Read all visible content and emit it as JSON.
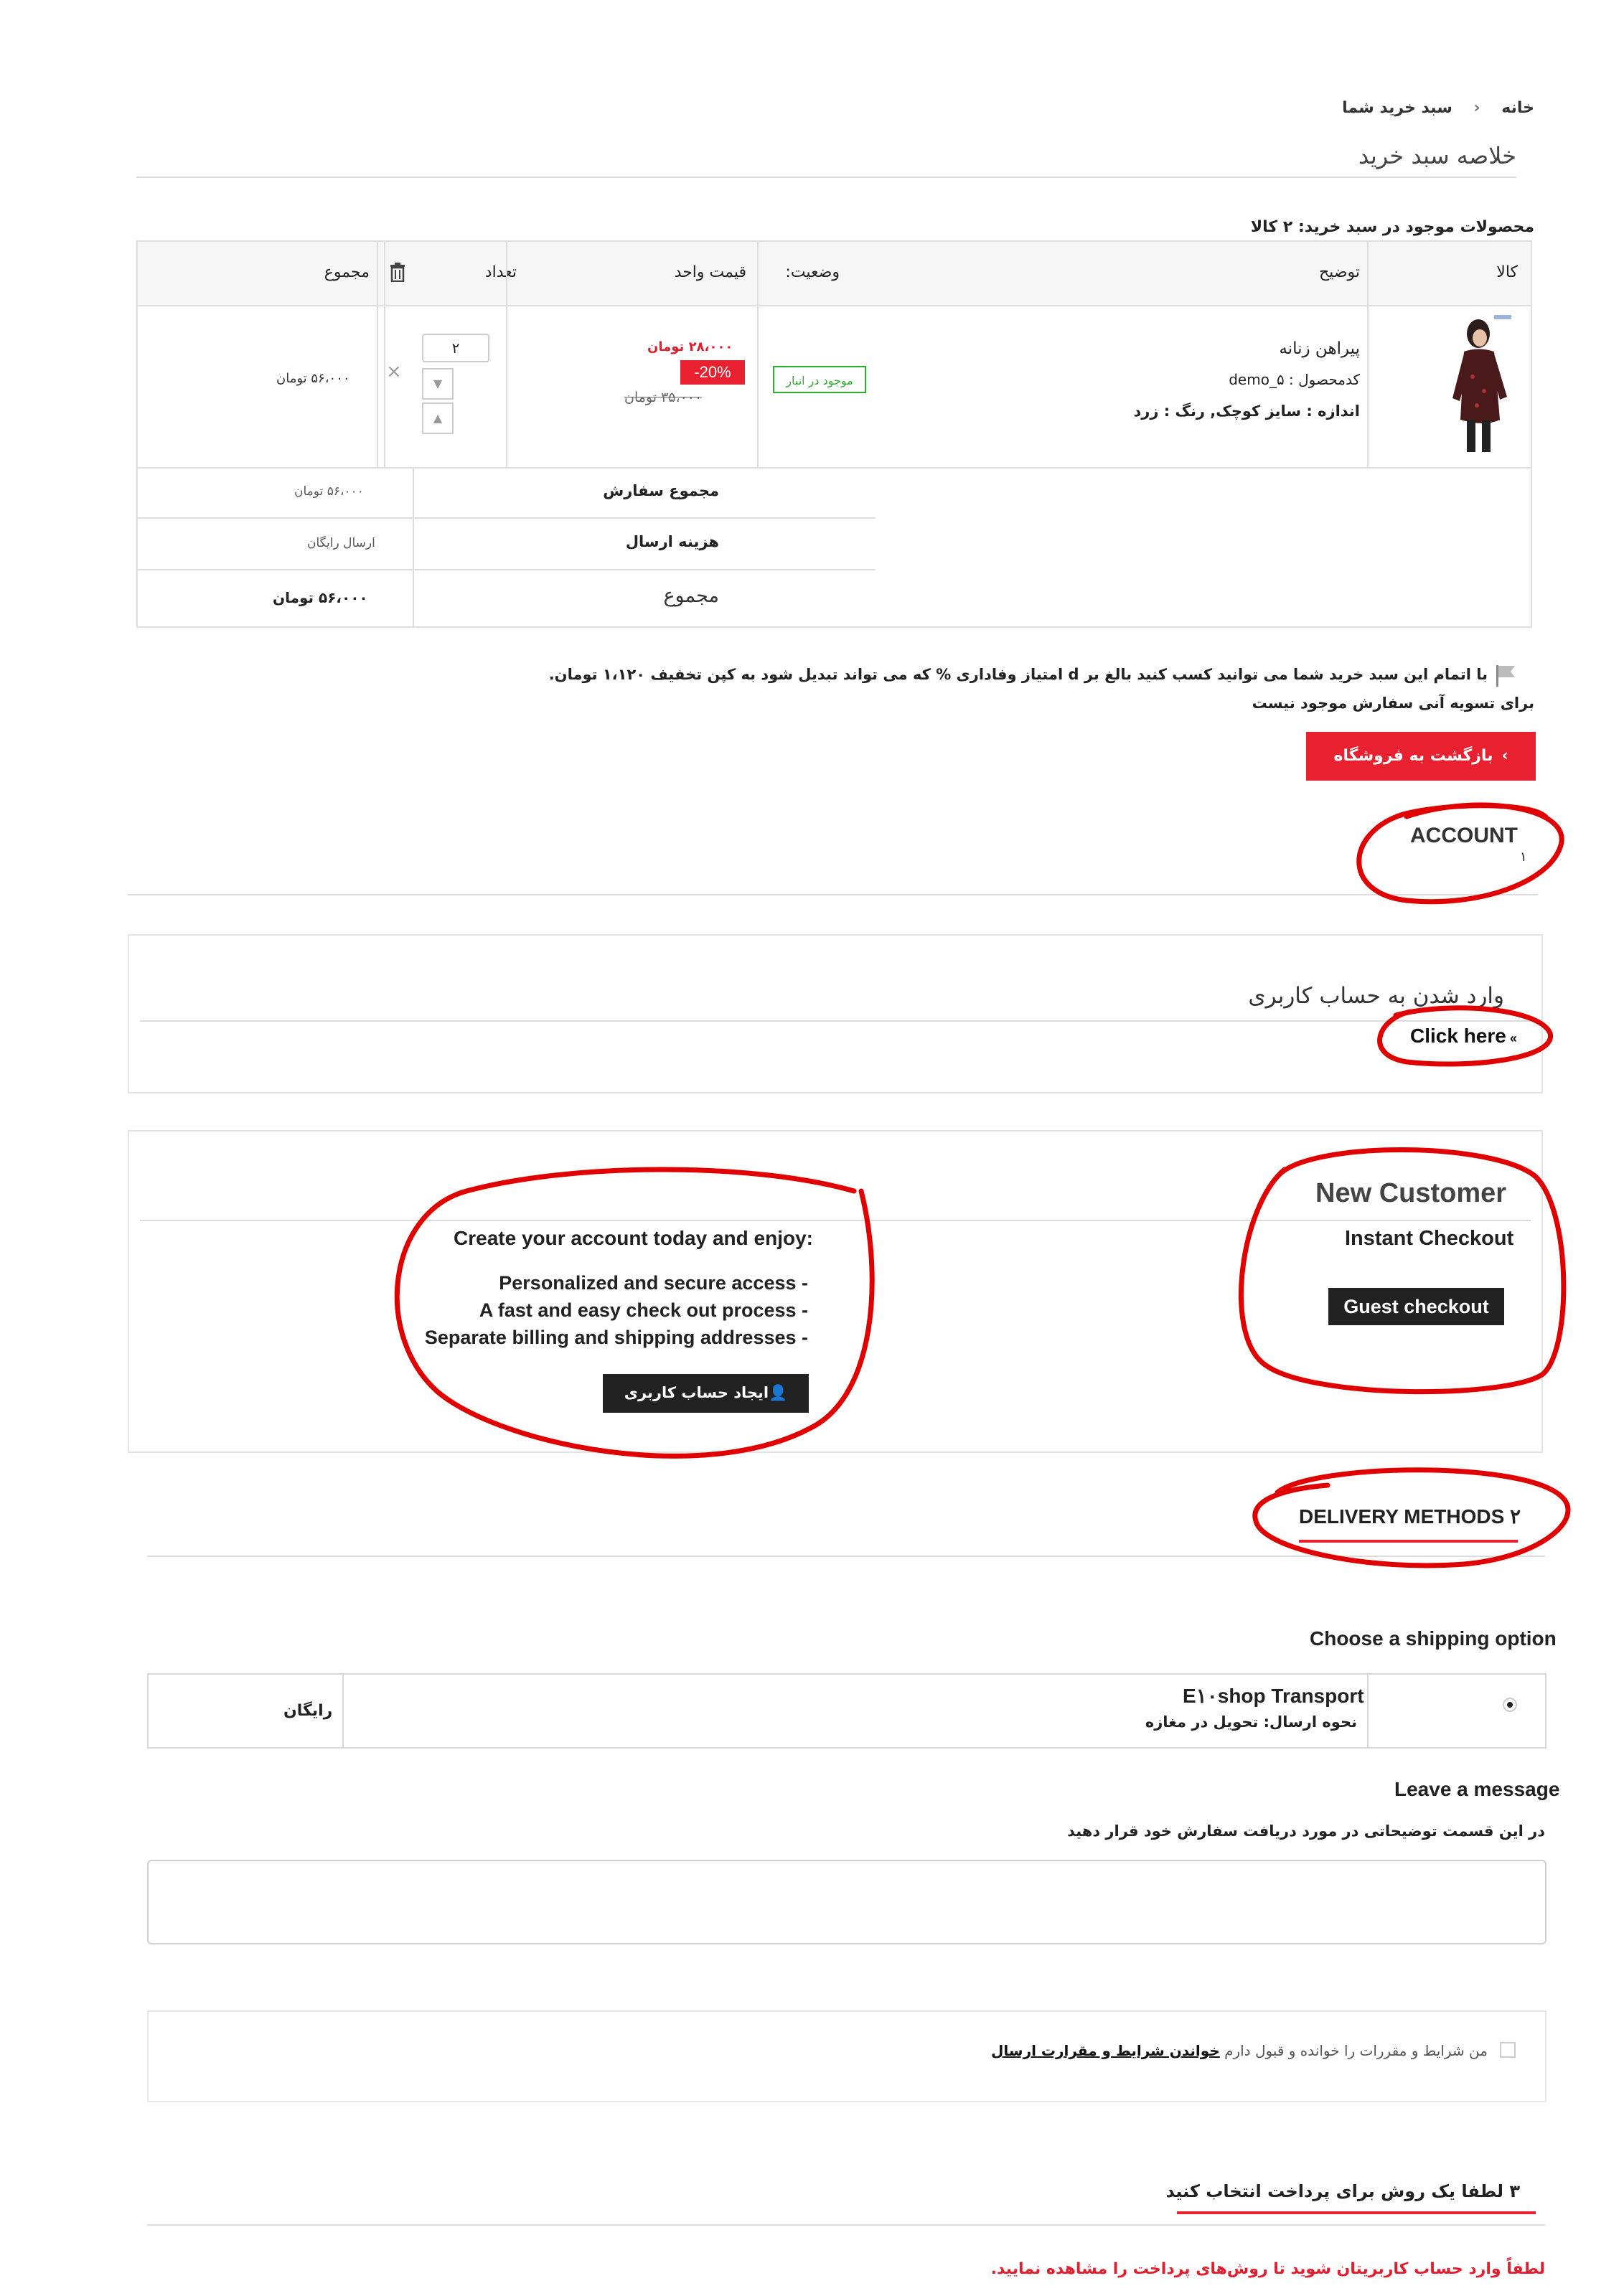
{
  "breadcrumb": {
    "home": "خانه",
    "current": "سبد خرید شما"
  },
  "page_title": "خلاصه سبد خرید",
  "cart_summary": "محصولات موجود در سبد خرید: ۲ کالا",
  "table": {
    "headers": {
      "product": "کالا",
      "description": "توضیح",
      "status": "وضعیت:",
      "unit_price": "قیمت واحد",
      "quantity": "تعداد",
      "total": "مجموع"
    },
    "row": {
      "name": "پیراهن زنانه",
      "code": "کدمحصول : demo_۵",
      "attributes": "اندازه : سایز کوچک, رنگ : زرد",
      "stock_badge": "موجود در انبار",
      "price_new": "۲۸،۰۰۰ تومان",
      "discount": "-20%",
      "price_old": "۳۵،۰۰۰ تومان",
      "qty": "۲",
      "line_total": "۵۶،۰۰۰ تومان"
    },
    "summary": [
      {
        "label": "مجموع سفارش",
        "value": "۵۶،۰۰۰ تومان"
      },
      {
        "label": "هزینه ارسال",
        "value": "ارسال رایگان"
      },
      {
        "label": "مجموع",
        "value": "۵۶،۰۰۰ تومان"
      }
    ]
  },
  "loyalty_text": "با اتمام این سبد خرید شما می توانید کسب کنید بالغ بر d امتیاز وفاداری % که می تواند تبدیل شود به کپن تخفیف ۱،۱۲۰ تومان.",
  "voucher_text": "برای تسویه آنی سفارش موجود نیست",
  "back_button": "بازگشت به فروشگاه",
  "account": {
    "heading": "ACCOUNT",
    "step": "۱"
  },
  "login": {
    "title": "وارد شدن به حساب کاربری",
    "link": "Click here"
  },
  "new_customer": {
    "heading": "New Customer",
    "subheading": "Instant Checkout",
    "guest_button": "Guest checkout",
    "intro": "Create your account today and enjoy:",
    "benefits": [
      "Personalized and secure access -",
      "A fast and easy check out process -",
      "Separate billing and shipping addresses -"
    ],
    "create_button": "ایجاد حساب کاربری"
  },
  "delivery": {
    "heading": "DELIVERY METHODS",
    "step": "۲",
    "choose": "Choose a shipping option",
    "carrier_name": "E۱۰shop Transport",
    "carrier_desc": "نحوه ارسال: تحویل در مغازه",
    "carrier_price": "رایگان"
  },
  "message": {
    "label": "Leave a message",
    "help": "در این قسمت توضیحاتی در مورد دریافت سفارش خود قرار دهید"
  },
  "terms": {
    "text": "من شرایط و مقررات را خوانده و قبول دارم",
    "link": "خواندن شرایط و مقرارت ارسال"
  },
  "payment": {
    "heading": "۳ لطفا یک روش برای پرداخت انتخاب کنید",
    "warning": "لطفاً وارد حساب کاربریتان شوید تا روش‌های پرداخت را مشاهده نمایید."
  },
  "colors": {
    "accent": "#e8202f",
    "annotation": "#e10000",
    "in_stock": "#2fae2f"
  }
}
